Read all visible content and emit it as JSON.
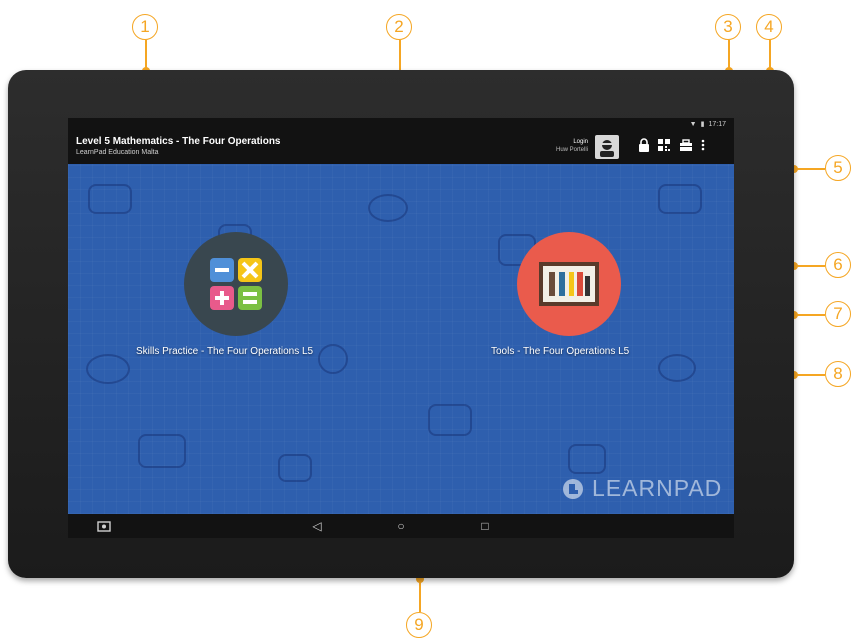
{
  "callouts": [
    "1",
    "2",
    "3",
    "4",
    "5",
    "6",
    "7",
    "8",
    "9"
  ],
  "status_bar": {
    "time": "17:17"
  },
  "app_bar": {
    "title": "Level 5 Mathematics - The Four Operations",
    "subtitle": "LearnPad Education Malta",
    "login_label": "Login",
    "user_name": "Huw Portelli"
  },
  "apps": [
    {
      "label": "Skills Practice - The Four Operations L5",
      "icon": "math-operations-icon",
      "color": "#39474f"
    },
    {
      "label": "Tools - The Four Operations L5",
      "icon": "art-tools-icon",
      "color": "#ea5b4c"
    }
  ],
  "watermark": "LEARNPAD",
  "nav": {
    "back": "◁",
    "home": "○",
    "recents": "□"
  },
  "colors": {
    "callout": "#f5a623",
    "wallpaper": "#2e5fae",
    "bezel": "#222222"
  }
}
